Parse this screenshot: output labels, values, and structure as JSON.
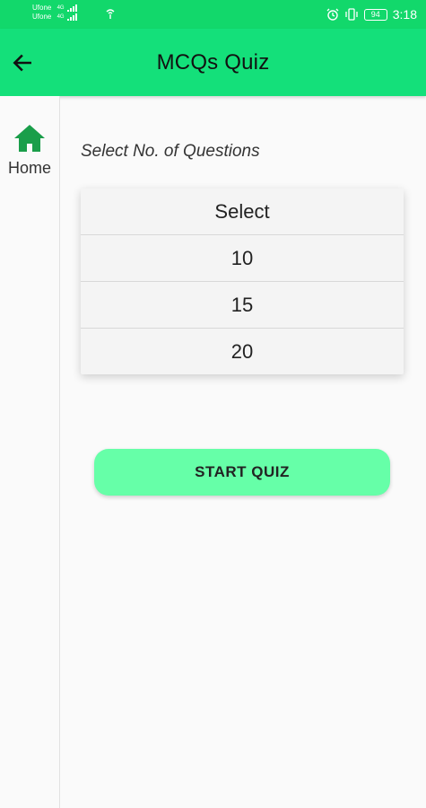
{
  "status_bar": {
    "carrier_1": "Ufone",
    "carrier_2": "Ufone",
    "network_1": "4G",
    "network_2": "4G",
    "battery": "94",
    "time": "3:18",
    "icons": [
      "signal-icon",
      "wifi-icon",
      "alarm-icon",
      "vibrate-icon",
      "battery-icon"
    ]
  },
  "app_bar": {
    "title": "MCQs Quiz",
    "back_icon": "arrow-left-icon"
  },
  "sidebar": {
    "items": [
      {
        "label": "Home",
        "icon": "home-icon"
      }
    ]
  },
  "main": {
    "prompt": "Select No. of Questions",
    "options": [
      "Select",
      "10",
      "15",
      "20"
    ],
    "start_button": "START QUIZ"
  },
  "colors": {
    "status_bar": "#12d86b",
    "app_bar": "#14e07a",
    "home_icon": "#1a9e4a",
    "start_button": "#66ffa8"
  }
}
